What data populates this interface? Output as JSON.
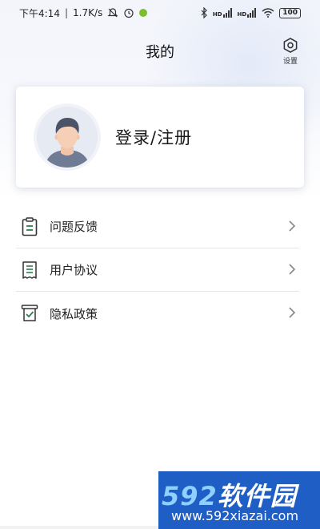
{
  "status_bar": {
    "time": "下午4:14",
    "speed": "1.7K/s",
    "sep": "|",
    "signal1": "HD",
    "signal2": "HD",
    "battery": "100"
  },
  "header": {
    "title": "我的",
    "settings_label": "设置"
  },
  "profile": {
    "login_label": "登录/注册"
  },
  "menu": {
    "items": [
      {
        "label": "问题反馈",
        "icon": "clipboard-icon"
      },
      {
        "label": "用户协议",
        "icon": "document-list-icon"
      },
      {
        "label": "隐私政策",
        "icon": "shield-check-icon"
      }
    ]
  },
  "watermark": {
    "logo_number": "592",
    "logo_text": "软件园",
    "url": "www.592xiazai.com"
  },
  "colors": {
    "accent_green": "#2e7d4f",
    "watermark_blue": "#1f5fc5"
  }
}
